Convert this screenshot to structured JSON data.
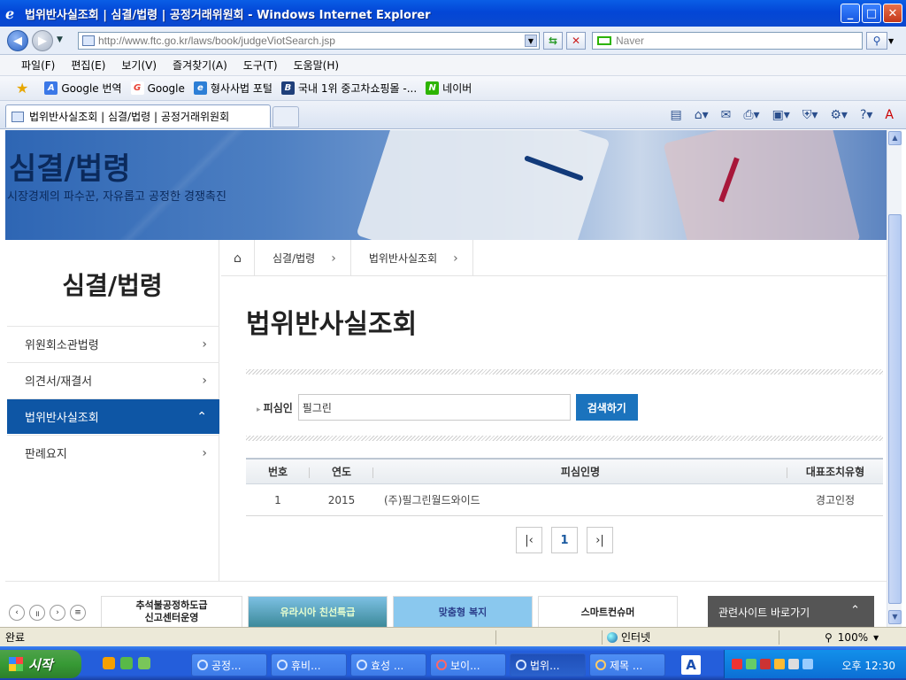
{
  "window": {
    "title": "법위반사실조회 | 심결/법령 | 공정거래위원회 - Windows Internet Explorer",
    "min": "_",
    "max": "□",
    "close": "✕"
  },
  "address": {
    "url": "http://www.ftc.go.kr/laws/book/judgeViotSearch.jsp",
    "search_placeholder": "Naver"
  },
  "menu": [
    "파일(F)",
    "편집(E)",
    "보기(V)",
    "즐겨찾기(A)",
    "도구(T)",
    "도움말(H)"
  ],
  "favorites": [
    {
      "label": "Google 번역",
      "icon": "translate-icon",
      "color": "#3b78e7"
    },
    {
      "label": "Google",
      "icon": "google-icon",
      "color": "#e94235"
    },
    {
      "label": "형사사법 포털",
      "icon": "ie-icon",
      "color": "#2d7fd6"
    },
    {
      "label": "국내 1위 중고차쇼핑몰 -...",
      "icon": "b-icon",
      "color": "#1f3f7a"
    },
    {
      "label": "네이버",
      "icon": "naver-icon",
      "color": "#2db400"
    }
  ],
  "tab": {
    "title": "법위반사실조회 | 심결/법령 | 공정거래위원회"
  },
  "banner": {
    "title": "심결/법령",
    "subtitle": "시장경제의 파수꾼, 자유롭고 공정한 경쟁촉진"
  },
  "leftnav": {
    "title": "심결/법령",
    "items": [
      {
        "label": "위원회소관법령",
        "active": false
      },
      {
        "label": "의견서/재결서",
        "active": false
      },
      {
        "label": "법위반사실조회",
        "active": true
      },
      {
        "label": "판례요지",
        "active": false
      }
    ]
  },
  "breadcrumb": [
    "심결/법령",
    "법위반사실조회"
  ],
  "page": {
    "title": "법위반사실조회",
    "search_label": "피심인",
    "search_value": "필그린",
    "search_button": "검색하기"
  },
  "table": {
    "headers": [
      "번호",
      "연도",
      "피심인명",
      "대표조치유형"
    ],
    "rows": [
      [
        "1",
        "2015",
        "(주)필그린월드와이드",
        "경고인정"
      ]
    ]
  },
  "pager": {
    "current": "1"
  },
  "footer": {
    "banner1_line1": "추석불공정하도급",
    "banner1_line2": "신고센터운영",
    "banner2": "유라시아 친선특급",
    "banner3": "맞춤형 복지",
    "banner4": "스마트컨슈머",
    "related": "관련사이트 바로가기"
  },
  "status": {
    "text": "완료",
    "zone": "인터넷",
    "zoom": "100%"
  },
  "taskbar": {
    "start": "시작",
    "items": [
      "공정...",
      "휴비...",
      "효성 ...",
      "보이...",
      "법위...",
      "제목 ..."
    ],
    "active_index": 4,
    "lang": "A",
    "clock": "오후 12:30"
  }
}
